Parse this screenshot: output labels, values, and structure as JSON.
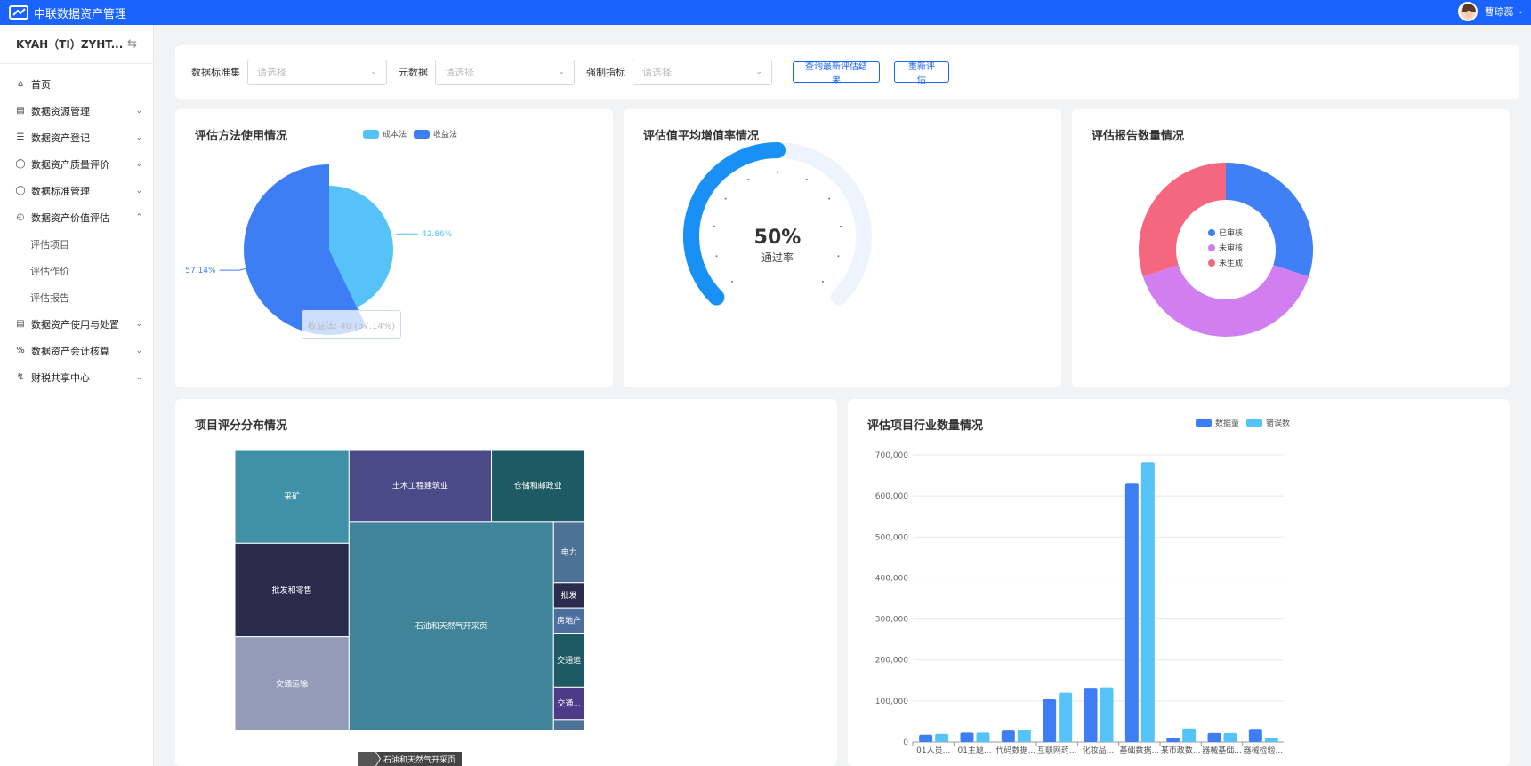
{
  "app": {
    "title": "中联数据资产管理",
    "user_name": "曹琼蕊"
  },
  "sidebar": {
    "org_name": "KYAH（TI）ZYHT...",
    "items": [
      {
        "label": "首页",
        "icon": "home-icon"
      },
      {
        "label": "数据资源管理",
        "icon": "book-icon"
      },
      {
        "label": "数据资产登记",
        "icon": "layers-icon"
      },
      {
        "label": "数据资产质量评价",
        "icon": "shield-icon"
      },
      {
        "label": "数据标准管理",
        "icon": "shield-icon"
      },
      {
        "label": "数据资产价值评估",
        "icon": "clock-icon"
      },
      {
        "label": "评估项目"
      },
      {
        "label": "评估作价"
      },
      {
        "label": "评估报告"
      },
      {
        "label": "数据资产使用与处置",
        "icon": "storage-icon"
      },
      {
        "label": "数据资产会计核算",
        "icon": "percent-icon"
      },
      {
        "label": "财税共享中心",
        "icon": "chart-icon"
      }
    ]
  },
  "filters": {
    "label1": "数据标准集",
    "label2": "元数据",
    "label3": "强制指标",
    "placeholder": "请选择",
    "btn_query": "查询最新评估结果",
    "btn_reeval": "重新评估"
  },
  "cards": {
    "methods_title": "评估方法使用情况",
    "growth_title": "评估值平均增值率情况",
    "reports_title": "评估报告数量情况",
    "treemap_title": "项目评分分布情况",
    "industry_title": "评估项目行业数量情况"
  },
  "colors": {
    "primary": "#1a63ff",
    "cost": "#55c3f7",
    "income": "#3d7ef5",
    "reviewed": "#3f80f6",
    "unreviewed": "#d17ff0",
    "ungenerated": "#f5677e"
  },
  "chart_data": [
    {
      "type": "pie",
      "legend": [
        "成本法",
        "收益法"
      ],
      "slices": [
        {
          "name": "成本法",
          "value": 30,
          "label": "42.86%"
        },
        {
          "name": "收益法",
          "value": 40,
          "label": "57.14%"
        }
      ],
      "tooltip": "收益法: 40 (57.14%)"
    },
    {
      "type": "gauge",
      "value": 50,
      "value_label": "50%",
      "subtitle": "通过率"
    },
    {
      "type": "pie",
      "legend": [
        "已审核",
        "未审核",
        "未生成"
      ],
      "slices": [
        {
          "name": "已审核",
          "value": 30
        },
        {
          "name": "未审核",
          "value": 40
        },
        {
          "name": "未生成",
          "value": 30
        }
      ]
    },
    {
      "type": "treemap",
      "breadcrumb": "石油和天然气开采页",
      "nodes": [
        {
          "name": "采矿",
          "value": 96
        },
        {
          "name": "批发和零售",
          "value": 96
        },
        {
          "name": "交通运输",
          "value": 96
        },
        {
          "name": "土木工程建筑业",
          "value": 92
        },
        {
          "name": "仓储和邮政业",
          "value": 60
        },
        {
          "name": "石油和天然气开采页",
          "value": 384
        },
        {
          "name": "电力",
          "value": 17
        },
        {
          "name": "批发",
          "value": 7
        },
        {
          "name": "房地产",
          "value": 7
        },
        {
          "name": "交通运",
          "value": 15
        },
        {
          "name": "交通...",
          "value": 9
        },
        {
          "name": "",
          "value": 3
        }
      ]
    },
    {
      "type": "bar",
      "categories": [
        "01人员...",
        "01主题...",
        "代码数据...",
        "互联网药...",
        "化妆品...",
        "基础数据...",
        "某市政数...",
        "器械基础...",
        "器械检验..."
      ],
      "series": [
        {
          "name": "数据量",
          "values": [
            18000,
            23000,
            28000,
            104000,
            132000,
            630000,
            10000,
            22000,
            32000
          ]
        },
        {
          "name": "错误数",
          "values": [
            20000,
            23000,
            30000,
            120000,
            133000,
            682000,
            33000,
            22000,
            10000
          ]
        }
      ],
      "yticks": [
        "0",
        "100,000",
        "200,000",
        "300,000",
        "400,000",
        "500,000",
        "600,000",
        "700,000"
      ],
      "ylim": [
        0,
        700000
      ]
    }
  ]
}
